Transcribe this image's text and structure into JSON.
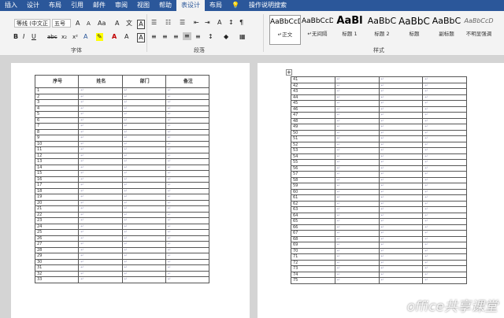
{
  "tabs": [
    "插入",
    "设计",
    "布局",
    "引用",
    "邮件",
    "审阅",
    "视图",
    "帮助",
    "表设计",
    "布局"
  ],
  "active_tab_index": 8,
  "tell_me": "操作说明搜索",
  "font": {
    "name": "等线 (中文正",
    "size": "五号",
    "bold": "B",
    "italic": "I",
    "underline": "U",
    "strike": "abc",
    "sub": "x₂",
    "sup": "x²",
    "group_label": "字体"
  },
  "paragraph": {
    "group_label": "段落"
  },
  "styles": {
    "group_label": "样式",
    "items": [
      {
        "sample": "AaBbCcDc",
        "name": "↵正文"
      },
      {
        "sample": "AaBbCcDc",
        "name": "↵无间隔"
      },
      {
        "sample": "AaBl",
        "name": "标题 1"
      },
      {
        "sample": "AaBbC",
        "name": "标题 2"
      },
      {
        "sample": "AaBbC",
        "name": "标题"
      },
      {
        "sample": "AaBbC",
        "name": "副标题"
      },
      {
        "sample": "AaBbCcD",
        "name": "不明显强调"
      }
    ]
  },
  "table": {
    "headers": [
      "序号",
      "姓名",
      "部门",
      "备注"
    ],
    "left_rows": [
      "1",
      "2",
      "3",
      "4",
      "5",
      "6",
      "7",
      "8",
      "9",
      "10",
      "11",
      "12",
      "13",
      "14",
      "15",
      "16",
      "17",
      "18",
      "19",
      "20",
      "21",
      "22",
      "23",
      "24",
      "25",
      "26",
      "27",
      "28",
      "29",
      "30",
      "31",
      "32",
      "33"
    ],
    "right_rows": [
      "41",
      "42",
      "43",
      "44",
      "45",
      "46",
      "47",
      "48",
      "49",
      "50",
      "51",
      "52",
      "53",
      "54",
      "55",
      "56",
      "57",
      "58",
      "59",
      "60",
      "61",
      "62",
      "63",
      "64",
      "65",
      "66",
      "67",
      "68",
      "69",
      "70",
      "71",
      "72",
      "73",
      "74",
      "75"
    ]
  },
  "watermark": "office共享课堂"
}
